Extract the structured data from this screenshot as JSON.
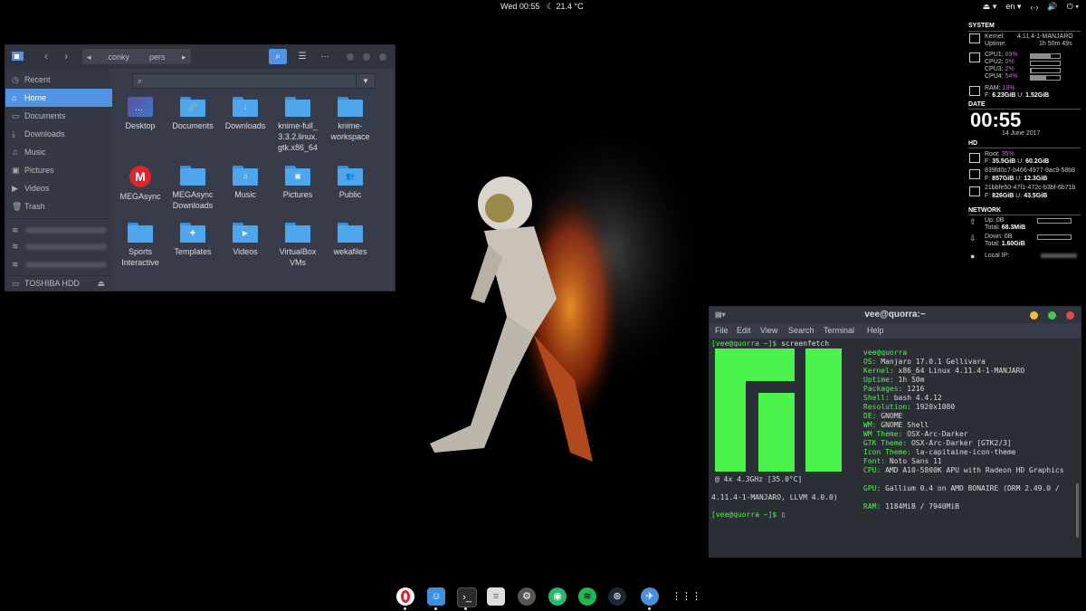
{
  "topbar": {
    "clock": "Wed 00:55",
    "weather": "21.4 °C",
    "language": "en",
    "icons": [
      "eject-icon",
      "language-menu",
      "network-icon",
      "volume-icon",
      "power-icon"
    ]
  },
  "filemanager": {
    "breadcrumbs": [
      ".conky",
      "pers"
    ],
    "sidebar": [
      {
        "label": "Recent",
        "icon": "clock-icon"
      },
      {
        "label": "Home",
        "icon": "home-icon",
        "active": true
      },
      {
        "label": "Documents",
        "icon": "document-icon"
      },
      {
        "label": "Downloads",
        "icon": "download-icon"
      },
      {
        "label": "Music",
        "icon": "music-icon"
      },
      {
        "label": "Pictures",
        "icon": "picture-icon"
      },
      {
        "label": "Videos",
        "icon": "video-icon"
      },
      {
        "label": "Trash",
        "icon": "trash-icon"
      }
    ],
    "device": "TOSHIBA HDD",
    "items": [
      {
        "label": "Desktop",
        "kind": "desktop"
      },
      {
        "label": "Documents",
        "glyph": "🔗"
      },
      {
        "label": "Downloads",
        "glyph": "↓"
      },
      {
        "label": "knime-full_ 3.3.2.linux. gtk.x86_64",
        "glyph": ""
      },
      {
        "label": "knime-workspace",
        "glyph": ""
      },
      {
        "label": "MEGAsync",
        "kind": "mega"
      },
      {
        "label": "MEGAsync Downloads",
        "glyph": ""
      },
      {
        "label": "Music",
        "glyph": "♫"
      },
      {
        "label": "Pictures",
        "glyph": "▣"
      },
      {
        "label": "Public",
        "glyph": "👥"
      },
      {
        "label": "Sports Interactive",
        "glyph": ""
      },
      {
        "label": "Templates",
        "glyph": "✚"
      },
      {
        "label": "Videos",
        "glyph": "▶"
      },
      {
        "label": "VirtualBox VMs",
        "glyph": ""
      },
      {
        "label": "wekafiles",
        "glyph": ""
      }
    ]
  },
  "conky": {
    "system_hdr": "SYSTEM",
    "kernel_label": "Kernel:",
    "kernel": "4.11.4-1-MANJARO",
    "uptime_label": "Uptime:",
    "uptime": "1h 50m 49s",
    "cpus": [
      {
        "label": "CPU1:",
        "value": "69%",
        "level": 0.69
      },
      {
        "label": "CPU2:",
        "value": "0%",
        "level": 0.0
      },
      {
        "label": "CPU3:",
        "value": "2%",
        "level": 0.02
      },
      {
        "label": "CPU4:",
        "value": "54%",
        "level": 0.54
      }
    ],
    "ram_label": "RAM:",
    "ram": "19%",
    "ram_f_label": "F:",
    "ram_free": "6.23GiB",
    "ram_u_label": "U:",
    "ram_used": "1.52GiB",
    "date_hdr": "DATE",
    "time": "00:55",
    "date": "14 June 2017",
    "hd_hdr": "HD",
    "root_label": "Root:",
    "root_pct": "35%",
    "disks": [
      {
        "f": "35.5GiB",
        "u": "60.2GiB"
      },
      {
        "name": "839fd0c7-b466-4977-9ac9-58b8",
        "f": "857GiB",
        "u": "12.3GiB"
      },
      {
        "name": "21bbfe50-47f1-472c-b3bf-6b71b",
        "f": "826GiB",
        "u": "43.5GiB"
      }
    ],
    "network_hdr": "NETWORK",
    "up_label": "Up:",
    "up": "0B",
    "up_total_label": "Total:",
    "up_total": "68.3MiB",
    "down_label": "Down:",
    "down": "0B",
    "down_total_label": "Total:",
    "down_total": "1.60GiB",
    "localip_label": "Local IP:"
  },
  "terminal": {
    "title": "vee@quorra:~",
    "menu": [
      "File",
      "Edit",
      "View",
      "Search",
      "Terminal",
      "Help"
    ],
    "prompt": "[vee@quorra ~]$",
    "cmd": "screenfetch",
    "user": "vee@quorra",
    "info": [
      {
        "k": "OS:",
        "v": " Manjaro 17.0.1 Gellivara"
      },
      {
        "k": "Kernel:",
        "v": " x86_64 Linux 4.11.4-1-MANJARO"
      },
      {
        "k": "Uptime:",
        "v": " 1h 50m"
      },
      {
        "k": "Packages:",
        "v": " 1216"
      },
      {
        "k": "Shell:",
        "v": " bash 4.4.12"
      },
      {
        "k": "Resolution:",
        "v": " 1920x1080"
      },
      {
        "k": "DE:",
        "v": " GNOME"
      },
      {
        "k": "WM:",
        "v": " GNOME Shell"
      },
      {
        "k": "WM Theme:",
        "v": " OSX-Arc-Darker"
      },
      {
        "k": "GTK Theme:",
        "v": " OSX-Arc-Darker [GTK2/3]"
      },
      {
        "k": "Icon Theme:",
        "v": " la-capitaine-icon-theme"
      },
      {
        "k": "Font:",
        "v": " Noto Sans 11"
      },
      {
        "k": "CPU:",
        "v": " AMD A10-5800K APU with Radeon HD Graphics"
      }
    ],
    "cpu_cont": "@ 4x 4.3GHz [35.0°C]",
    "gpu_k": "GPU:",
    "gpu_v": " Gallium 0.4 on AMD BONAIRE (DRM 2.49.0 /",
    "gpu_cont": "4.11.4-1-MANJARO, LLVM 4.0.0)",
    "ram_k": "RAM:",
    "ram_v": " 1184MiB / 7940MiB"
  },
  "dock": [
    "opera-icon",
    "finder-icon",
    "terminal-icon",
    "text-editor-icon",
    "settings-icon",
    "ghost-icon",
    "spotify-icon",
    "steam-icon",
    "bird-icon",
    "app-grid-icon"
  ]
}
